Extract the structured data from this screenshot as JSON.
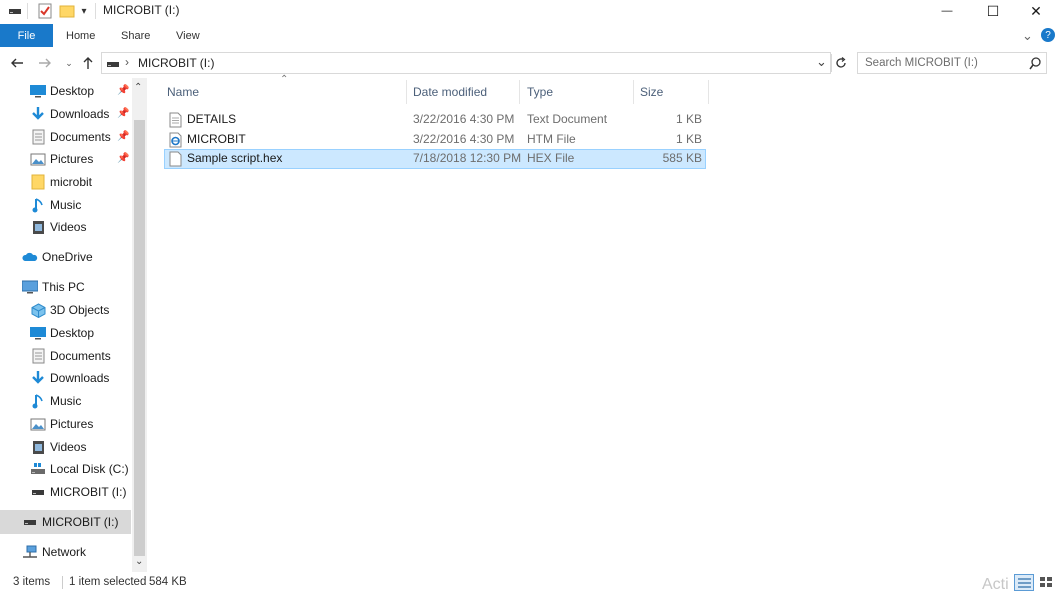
{
  "window": {
    "title": "MICROBIT (I:)",
    "quick_access_dropdown": "▾",
    "minimize": "—",
    "maximize": "☐",
    "close": "✕"
  },
  "ribbon": {
    "file": "File",
    "tabs": [
      "Home",
      "Share",
      "View"
    ],
    "expand": "⌄",
    "help": "?"
  },
  "address": {
    "path": "MICROBIT (I:)",
    "separator": "›",
    "search_placeholder": "Search MICROBIT (I:)"
  },
  "nav": {
    "quick_access": [
      {
        "label": "Desktop",
        "icon": "desktop-icon",
        "pinned": true
      },
      {
        "label": "Downloads",
        "icon": "downloads-icon",
        "pinned": true
      },
      {
        "label": "Documents",
        "icon": "documents-icon",
        "pinned": true
      },
      {
        "label": "Pictures",
        "icon": "pictures-icon",
        "pinned": true
      },
      {
        "label": "microbit",
        "icon": "folder-icon",
        "pinned": false
      },
      {
        "label": "Music",
        "icon": "music-icon",
        "pinned": false
      },
      {
        "label": "Videos",
        "icon": "videos-icon",
        "pinned": false
      }
    ],
    "onedrive": "OneDrive",
    "this_pc": "This PC",
    "this_pc_items": [
      {
        "label": "3D Objects",
        "icon": "3d-objects-icon"
      },
      {
        "label": "Desktop",
        "icon": "desktop-icon"
      },
      {
        "label": "Documents",
        "icon": "documents-icon"
      },
      {
        "label": "Downloads",
        "icon": "downloads-icon"
      },
      {
        "label": "Music",
        "icon": "music-icon"
      },
      {
        "label": "Pictures",
        "icon": "pictures-icon"
      },
      {
        "label": "Videos",
        "icon": "videos-icon"
      },
      {
        "label": "Local Disk (C:)",
        "icon": "local-disk-icon"
      },
      {
        "label": "MICROBIT (I:)",
        "icon": "drive-icon"
      }
    ],
    "selected_drive": "MICROBIT (I:)",
    "network": "Network"
  },
  "content": {
    "columns": {
      "name": "Name",
      "date": "Date modified",
      "type": "Type",
      "size": "Size"
    },
    "files": [
      {
        "name": "DETAILS",
        "date": "3/22/2016 4:30 PM",
        "type": "Text Document",
        "size": "1 KB",
        "icon": "text-file-icon",
        "selected": false
      },
      {
        "name": "MICROBIT",
        "date": "3/22/2016 4:30 PM",
        "type": "HTM File",
        "size": "1 KB",
        "icon": "html-file-icon",
        "selected": false
      },
      {
        "name": "Sample script.hex",
        "date": "7/18/2018 12:30 PM",
        "type": "HEX File",
        "size": "585 KB",
        "icon": "file-icon",
        "selected": true
      }
    ]
  },
  "status": {
    "count": "3 items",
    "selected": "1 item selected",
    "size": "584 KB"
  },
  "watermark": "Acti",
  "colors": {
    "accent": "#1979ca",
    "selection": "#cce8ff",
    "selection_border": "#99d1ff",
    "nav_selected": "#d9d9d9",
    "header_text": "#4c607a"
  }
}
